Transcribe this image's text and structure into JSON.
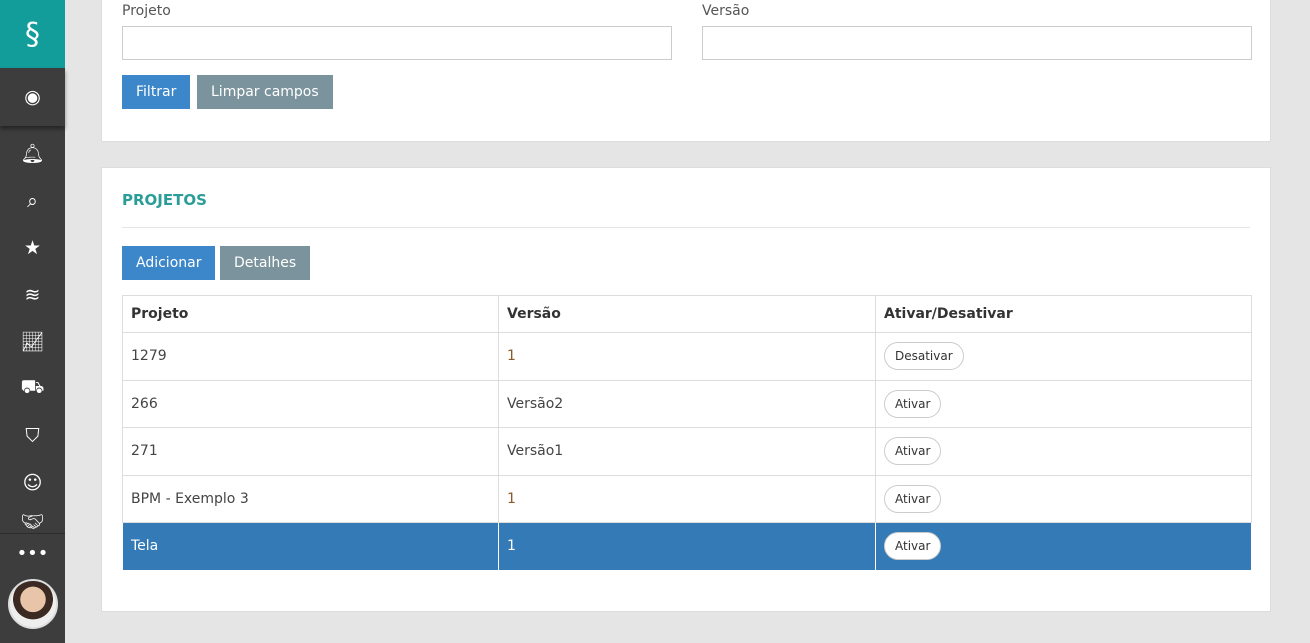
{
  "sidebar": {
    "items": [
      "user",
      "bell",
      "search",
      "star",
      "layers",
      "chart",
      "tractor",
      "shield",
      "team",
      "handshake"
    ],
    "more": "•••"
  },
  "filter": {
    "projeto_label": "Projeto",
    "versao_label": "Versão",
    "projeto_value": "",
    "versao_value": "",
    "filtrar": "Filtrar",
    "limpar": "Limpar campos"
  },
  "projetos": {
    "title": "PROJETOS",
    "adicionar": "Adicionar",
    "detalhes": "Detalhes",
    "columns": [
      "Projeto",
      "Versão",
      "Ativar/Desativar"
    ],
    "rows": [
      {
        "projeto": "1279",
        "versao": "1",
        "action": "Desativar"
      },
      {
        "projeto": "266",
        "versao": "Versão2",
        "action": "Ativar"
      },
      {
        "projeto": "271",
        "versao": "Versão1",
        "action": "Ativar"
      },
      {
        "projeto": "BPM - Exemplo 3",
        "versao": "1",
        "action": "Ativar"
      },
      {
        "projeto": "Tela",
        "versao": "1",
        "action": "Ativar"
      }
    ]
  }
}
